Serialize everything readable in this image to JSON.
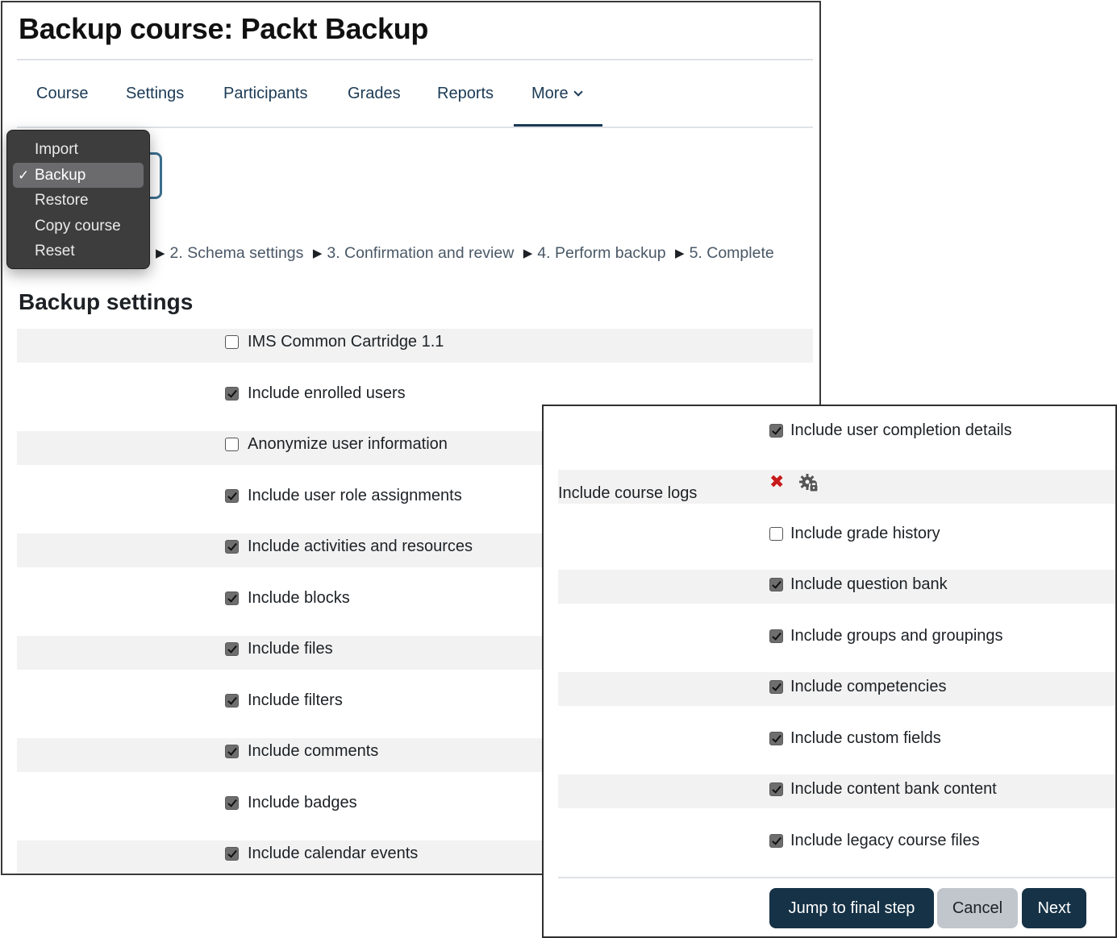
{
  "page": {
    "title": "Backup course: Packt Backup"
  },
  "nav": {
    "tabs": [
      {
        "label": "Course"
      },
      {
        "label": "Settings"
      },
      {
        "label": "Participants"
      },
      {
        "label": "Grades"
      },
      {
        "label": "Reports"
      },
      {
        "label": "More",
        "active": true
      }
    ]
  },
  "dropdown": {
    "items": [
      {
        "label": "Import",
        "selected": false
      },
      {
        "label": "Backup",
        "selected": true
      },
      {
        "label": "Restore",
        "selected": false
      },
      {
        "label": "Copy course",
        "selected": false
      },
      {
        "label": "Reset",
        "selected": false
      }
    ],
    "check_glyph": "✓"
  },
  "progress": {
    "arrow_glyph": "▶",
    "steps": [
      "2. Schema settings",
      "3. Confirmation and review",
      "4. Perform backup",
      "5. Complete"
    ]
  },
  "backup_settings": {
    "title": "Backup settings",
    "items": [
      {
        "label": "IMS Common Cartridge 1.1",
        "checked": false
      },
      {
        "label": "Include enrolled users",
        "checked": true
      },
      {
        "label": "Anonymize user information",
        "checked": false
      },
      {
        "label": "Include user role assignments",
        "checked": true
      },
      {
        "label": "Include activities and resources",
        "checked": true
      },
      {
        "label": "Include blocks",
        "checked": true
      },
      {
        "label": "Include files",
        "checked": true
      },
      {
        "label": "Include filters",
        "checked": true
      },
      {
        "label": "Include comments",
        "checked": true
      },
      {
        "label": "Include badges",
        "checked": true
      },
      {
        "label": "Include calendar events",
        "checked": true
      }
    ]
  },
  "more_settings": {
    "items": [
      {
        "label": "Include user completion details",
        "checked": true
      },
      {
        "label": "Include course logs",
        "type": "locked",
        "icons": [
          "x-icon",
          "gear-lock-icon"
        ],
        "x_glyph": "✖"
      },
      {
        "label": "Include grade history",
        "checked": false
      },
      {
        "label": "Include question bank",
        "checked": true
      },
      {
        "label": "Include groups and groupings",
        "checked": true
      },
      {
        "label": "Include competencies",
        "checked": true
      },
      {
        "label": "Include custom fields",
        "checked": true
      },
      {
        "label": "Include content bank content",
        "checked": true
      },
      {
        "label": "Include legacy course files",
        "checked": true
      }
    ]
  },
  "buttons": {
    "jump": "Jump to final step",
    "cancel": "Cancel",
    "next": "Next"
  },
  "colors": {
    "primary": "#163246",
    "nav_text": "#1b3a55",
    "secondary_button": "#c0c6cc",
    "denied_red": "#c71a1a"
  }
}
